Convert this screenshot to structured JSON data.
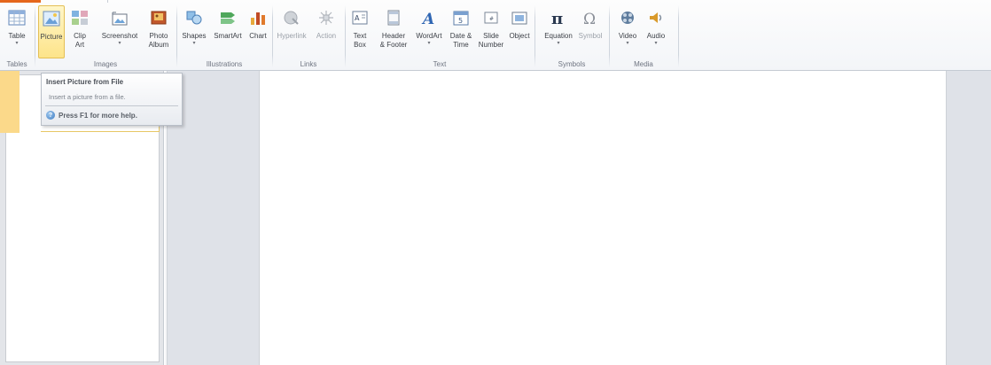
{
  "ribbon": {
    "groups": {
      "tables": "Tables",
      "images": "Images",
      "illustrations": "Illustrations",
      "links": "Links",
      "text": "Text",
      "symbols": "Symbols",
      "media": "Media"
    },
    "buttons": {
      "table": "Table",
      "picture": "Picture",
      "clip_art": "Clip\nArt",
      "screenshot": "Screenshot",
      "photo_album": "Photo\nAlbum",
      "shapes": "Shapes",
      "smartart": "SmartArt",
      "chart": "Chart",
      "hyperlink": "Hyperlink",
      "action": "Action",
      "text_box": "Text\nBox",
      "header_footer": "Header\n& Footer",
      "wordart": "WordArt",
      "date_time": "Date &\nTime",
      "slide_number": "Slide\nNumber",
      "object": "Object",
      "equation": "Equation",
      "symbol": "Symbol",
      "video": "Video",
      "audio": "Audio"
    },
    "dropdown_arrow": "▾"
  },
  "tooltip": {
    "title": "Insert Picture from File",
    "description": "Insert a picture from a file.",
    "help": "Press F1 for more help.",
    "help_glyph": "?"
  },
  "colors": {
    "accent": "#e5661c",
    "active_button": "#fde48a",
    "editor_bg": "#dfe2e8"
  }
}
